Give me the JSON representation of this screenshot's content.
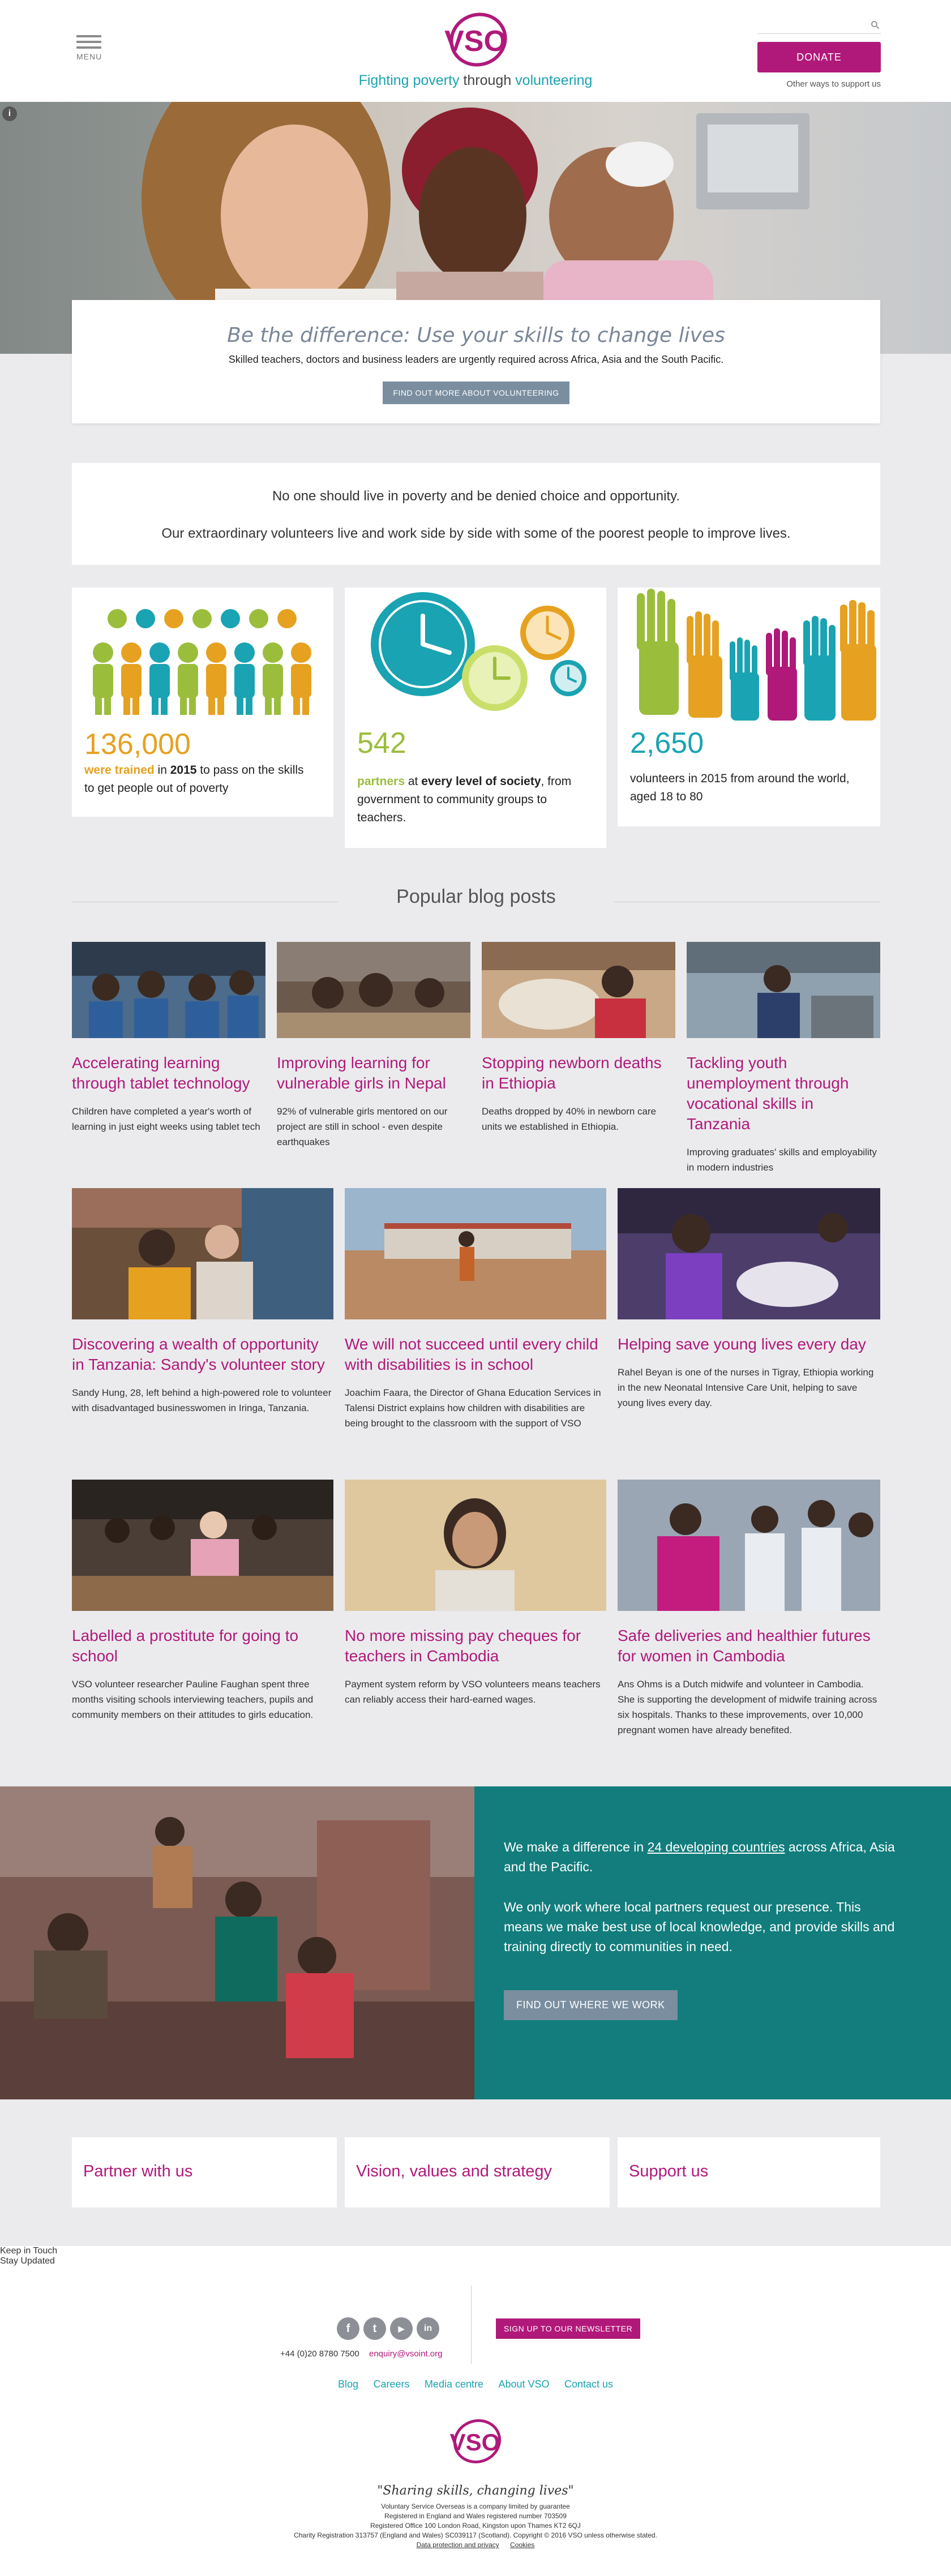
{
  "header": {
    "menu_label": "MENU",
    "logo_text": "VSO",
    "tagline": {
      "part1": "Fighting poverty",
      "part2": " through ",
      "part3": "volunteering"
    },
    "search_placeholder": "",
    "donate_label": "DONATE",
    "other_ways": "Other ways to support us"
  },
  "hero": {
    "title": "Be the difference: Use your skills to change lives",
    "subtitle": "Skilled teachers, doctors and business leaders are urgently required across Africa, Asia and the South Pacific.",
    "cta": "FIND OUT MORE ABOUT VOLUNTEERING",
    "info_icon": "i"
  },
  "intro": {
    "line1": "No one should live in poverty and be denied choice and opportunity.",
    "line2": "Our extraordinary volunteers live and work side by side with some of the poorest people to improve lives."
  },
  "stats": [
    {
      "number": "136,000",
      "highlight": "were trained",
      "rest_a": " in ",
      "bold_b": "2015",
      "rest_b": " to pass on the skills to get people out of poverty",
      "color": "#e6a120"
    },
    {
      "number": "542",
      "highlight": "partners",
      "rest_a": " at ",
      "bold_b": "every level of society",
      "rest_b": ", from government to community groups to teachers.",
      "color": "#9bbd3c"
    },
    {
      "number": "2,650",
      "highlight": "",
      "rest_a": "volunteers in 2015 from around the world, aged 18 to 80",
      "bold_b": "",
      "rest_b": "",
      "color": "#1aa3b2"
    }
  ],
  "blog": {
    "heading": "Popular blog posts",
    "posts": [
      {
        "title": "Accelerating learning through tablet technology",
        "text": "Children have completed a year's worth of learning in just eight weeks using tablet tech"
      },
      {
        "title": "Improving learning for vulnerable girls in Nepal",
        "text": "92% of vulnerable girls mentored on our project are still in school - even despite earthquakes"
      },
      {
        "title": "Stopping newborn deaths in Ethiopia",
        "text": "Deaths dropped by 40% in newborn care units we established in Ethiopia."
      },
      {
        "title": "Tackling youth unemployment through vocational skills in Tanzania",
        "text": "Improving graduates' skills and employability in modern industries"
      },
      {
        "title": "Discovering a wealth of opportunity in Tanzania: Sandy's volunteer story",
        "text": "Sandy Hung, 28, left behind a high-powered role to volunteer with disadvantaged businesswomen in Iringa, Tanzania."
      },
      {
        "title": "We will not succeed until every child with disabilities is in school",
        "text": "Joachim Faara, the Director of Ghana Education Services in Talensi District explains how children with disabilities are being brought to the classroom with the support of VSO"
      },
      {
        "title": "Helping save young lives every day",
        "text": "Rahel Beyan is one of the nurses in Tigray, Ethiopia working in the new Neonatal Intensive Care Unit, helping to save young lives every day."
      },
      {
        "title": "Labelled a prostitute for going to school",
        "text": "VSO volunteer researcher Pauline Faughan spent three months visiting schools interviewing teachers, pupils and community members on their attitudes to girls education."
      },
      {
        "title": "No more missing pay cheques for teachers in Cambodia",
        "text": "Payment system reform by VSO volunteers means teachers can reliably access their hard-earned wages."
      },
      {
        "title": "Safe deliveries and healthier futures for women in Cambodia",
        "text": "Ans Ohms is a Dutch midwife and volunteer in Cambodia. She is supporting the development of midwife training across six hospitals. Thanks to these improvements, over 10,000 pregnant women have already benefited."
      }
    ]
  },
  "work": {
    "p1_a": "We make a difference in ",
    "p1_link": "24 developing countries",
    "p1_b": " across Africa, Asia and the Pacific.",
    "p2": "We only work where local partners request our presence. This means we make best use of local knowledge, and provide skills and training directly to communities in need.",
    "cta": "FIND OUT WHERE WE WORK"
  },
  "link_boxes": [
    "Partner with us",
    "Vision, values and strategy",
    "Support us"
  ],
  "footer": {
    "keep_in_touch": "Keep in Touch",
    "stay_updated": "Stay Updated",
    "social": [
      {
        "icon": "facebook-icon",
        "glyph": "f"
      },
      {
        "icon": "twitter-icon",
        "glyph": "t"
      },
      {
        "icon": "youtube-icon",
        "glyph": "▶"
      },
      {
        "icon": "linkedin-icon",
        "glyph": "in"
      }
    ],
    "phone": "+44 (0)20 8780 7500",
    "email": "enquiry@vsoint.org",
    "newsletter": "SIGN UP TO OUR NEWSLETTER",
    "links": [
      "Blog",
      "Careers",
      "Media centre",
      "About VSO",
      "Contact us"
    ],
    "motto": "\"Sharing skills, changing lives\"",
    "legal": [
      "Voluntary Service Overseas is a company limited by guarantee",
      "Registered in England and Wales registered number 703509",
      "Registered Office 100 London Road, Kingston upon Thames KT2 6QJ",
      "Charity Registration 313757 (England and Wales) SC039117 (Scotland). Copyright © 2016 VSO unless otherwise stated."
    ],
    "legal_links": [
      "Data protection and privacy",
      "Cookies"
    ]
  },
  "colors": {
    "brand": "#b0197a",
    "teal": "#1aa3b2",
    "green": "#9bbd3c",
    "orange": "#e6a120",
    "work_panel": "#127d7c"
  }
}
